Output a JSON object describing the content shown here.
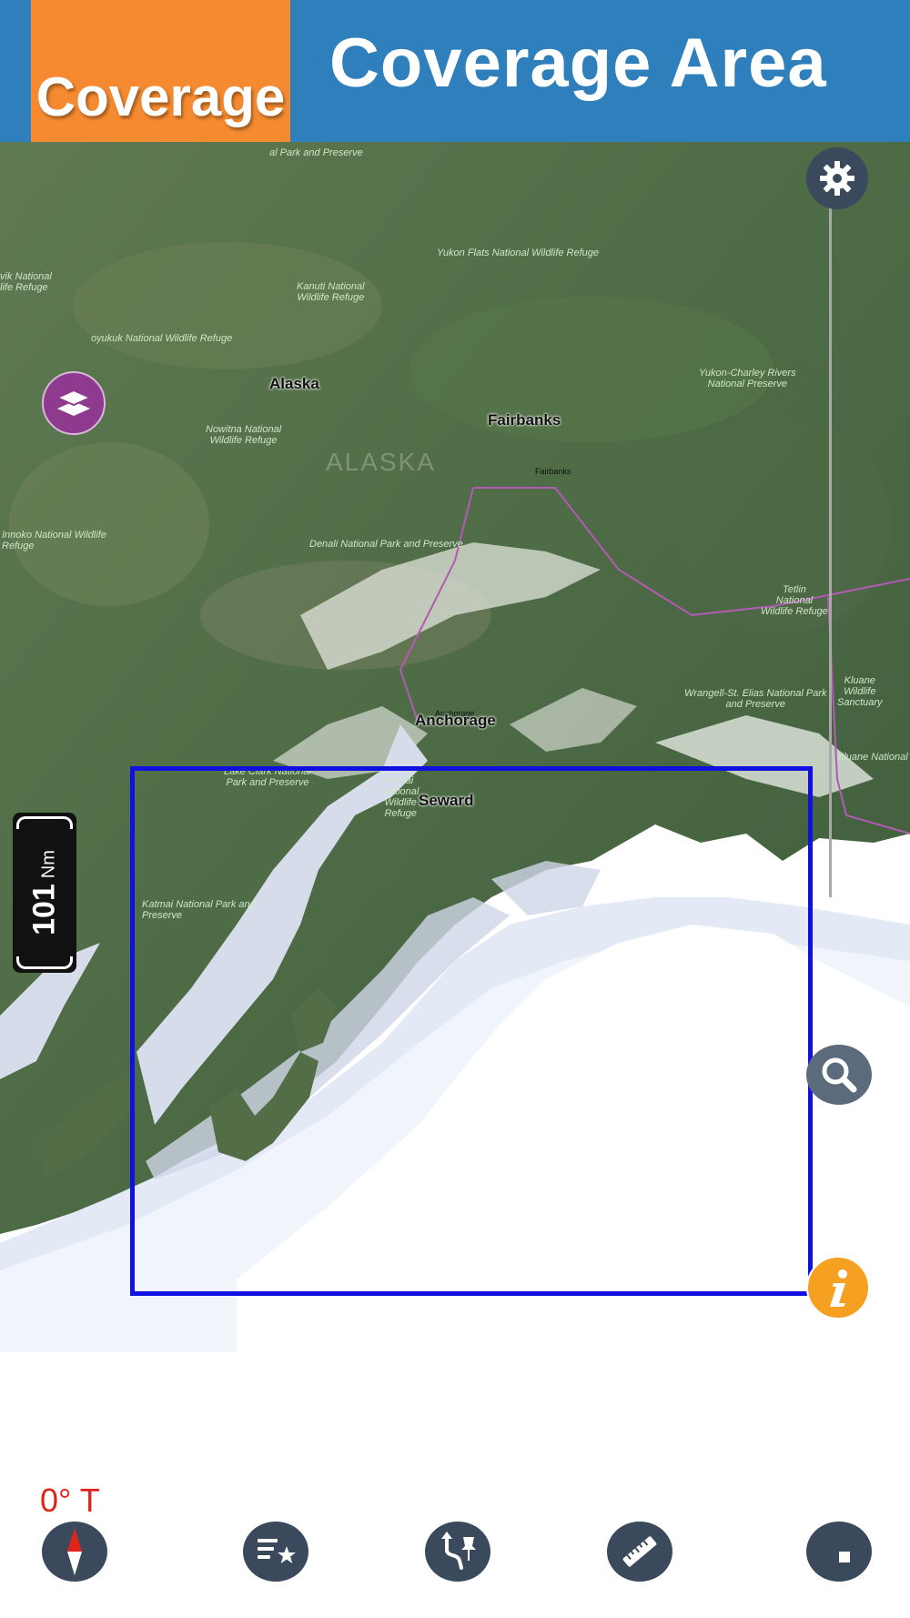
{
  "header": {
    "title": "Coverage Area",
    "ribbon_label": "Coverage"
  },
  "map": {
    "labels": {
      "park_preserve_top": "al Park and Preserve",
      "yukon_flats": "Yukon Flats National Wildlife Refuge",
      "koyukuk_left": "vik National\nlife Refuge",
      "kanuti": "Kanuti National\nWildlife Refuge",
      "koyukuk": "oyukuk National Wildlife Refuge",
      "alaska": "Alaska",
      "yukon_charley": "Yukon-Charley Rivers\nNational Preserve",
      "fairbanks_small": "Fairbanks",
      "fairbanks": "Fairbanks",
      "nowitna": "Nowitna National\nWildlife Refuge",
      "alaska_faint": "ALASKA",
      "innoko": "Innoko National Wildlife\nRefuge",
      "denali": "Denali National Park and Preserve",
      "tetlin": "Tetlin\nNational\nWildlife Refuge",
      "kluane_sanctuary": "Kluane\nWildlife\nSanctuary",
      "wrangell": "Wrangell-St. Elias National Park\nand Preserve",
      "anchorage_small": "Anchorage",
      "anchorage": "Anchorage",
      "kluane_national": "Kluane National",
      "lake_clark": "Lake Clark National\nPark and Preserve",
      "kenai": "Kenai\nNational\nWildlife\nRefuge",
      "seward": "Seward",
      "katmai": "Katmai National Park and\nPreserve"
    },
    "scale": {
      "value": "101",
      "unit": "Nm"
    },
    "heading": "0° T"
  },
  "icons": {
    "settings": "gear-icon",
    "layers": "layers-icon",
    "search": "search-icon",
    "info": "info-icon",
    "compass": "compass-icon",
    "favorites": "favorites-list-icon",
    "route": "route-icon",
    "measure": "ruler-icon",
    "stop": "stop-icon"
  },
  "colors": {
    "header": "#2f7fbd",
    "ribbon": "#f58a30",
    "coverage_box": "#1010e0",
    "heading_text": "#e2231a"
  }
}
